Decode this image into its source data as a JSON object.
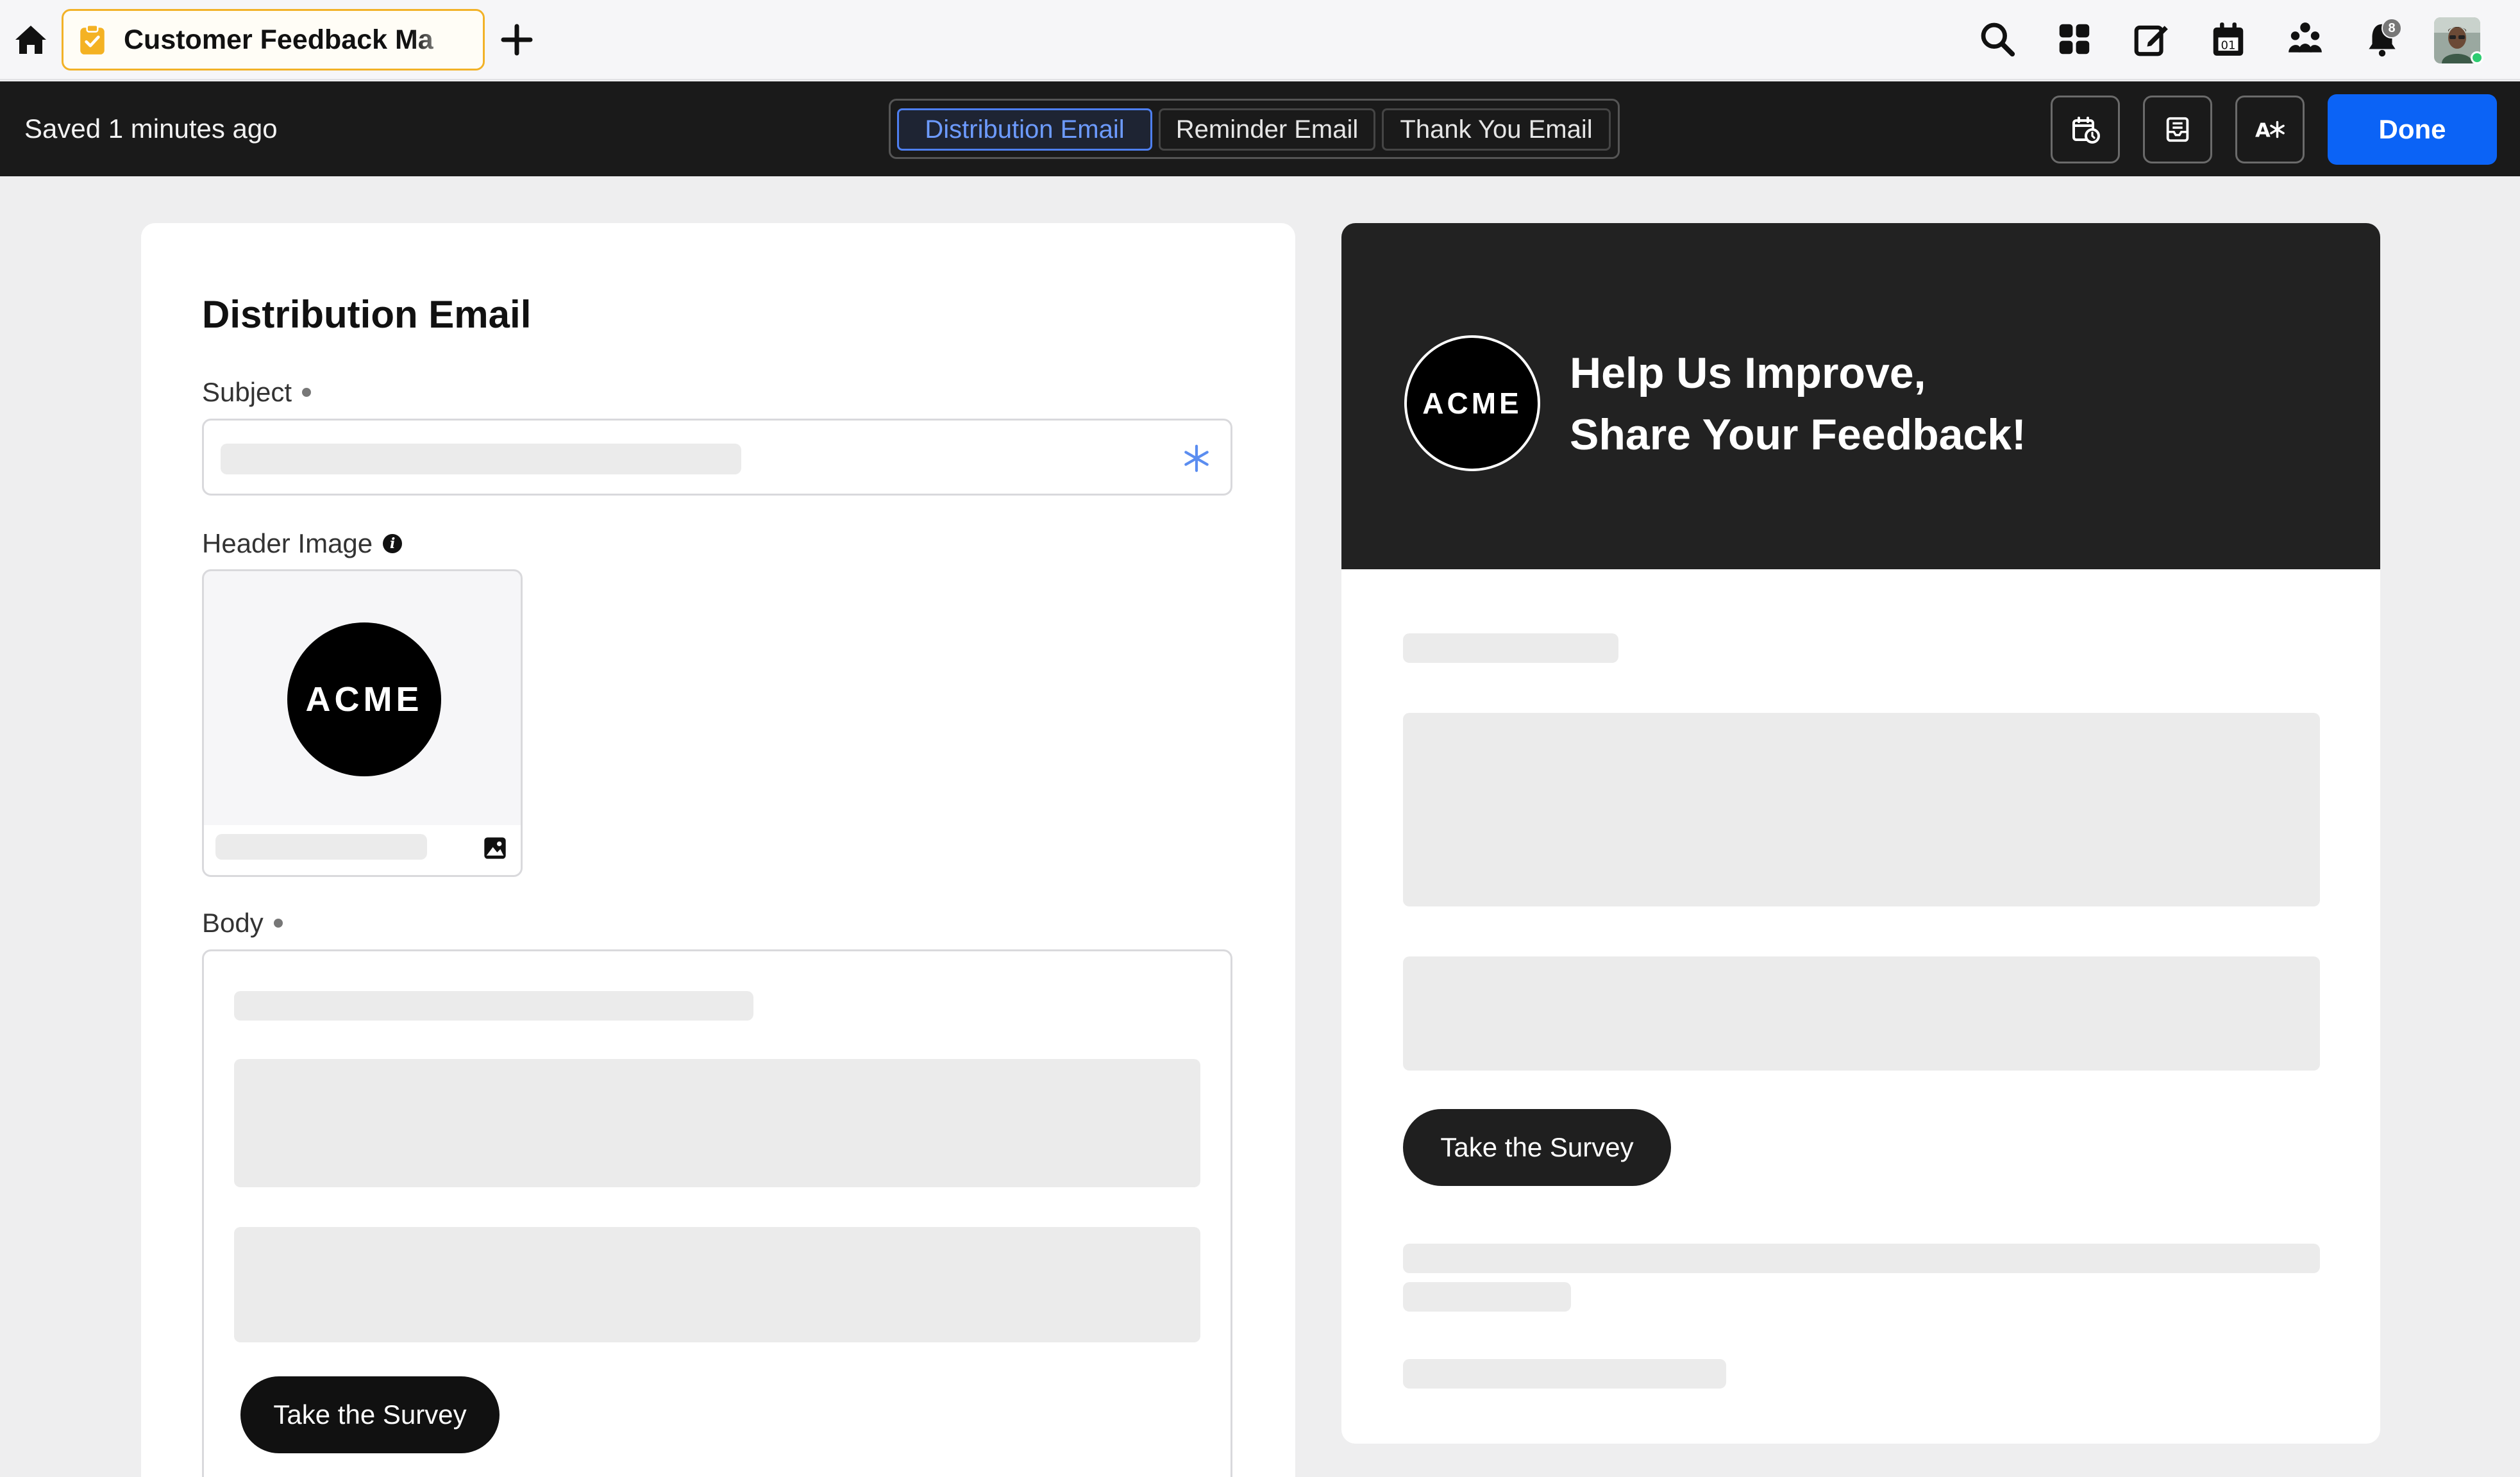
{
  "topbar": {
    "tab_title": "Customer Feedback Ma",
    "notification_count": "8"
  },
  "toolbar": {
    "saved_status": "Saved 1 minutes ago",
    "tabs": [
      {
        "label": "Distribution Email",
        "active": true
      },
      {
        "label": "Reminder Email",
        "active": false
      },
      {
        "label": "Thank You Email",
        "active": false
      }
    ],
    "done_label": "Done"
  },
  "editor": {
    "title": "Distribution Email",
    "subject_label": "Subject",
    "header_image_label": "Header Image",
    "header_image_info": "i",
    "logo_text": "ACME",
    "body_label": "Body",
    "cta_label": "Take the Survey"
  },
  "preview": {
    "logo_text": "ACME",
    "headline_line1": "Help Us Improve,",
    "headline_line2": "Share Your Feedback!",
    "cta_label": "Take the Survey"
  },
  "colors": {
    "accent": "#0b63f6",
    "active_tab": "#4e7ff0",
    "tab_highlight": "#f2b227",
    "dark_bar": "#1a1a1a",
    "preview_header": "#222222"
  }
}
